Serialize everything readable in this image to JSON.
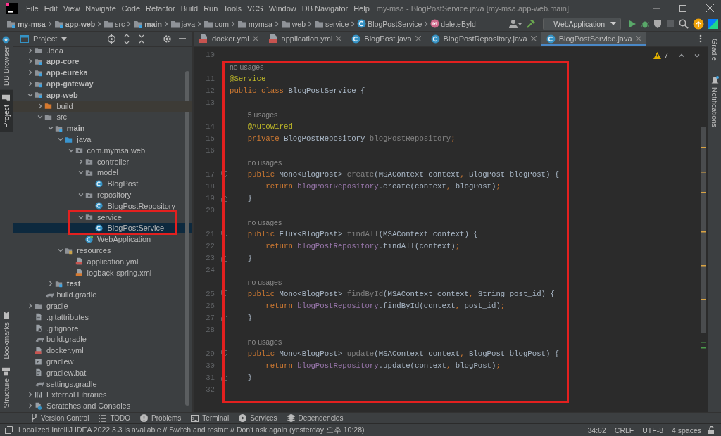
{
  "window": {
    "title": "my-msa - BlogPostService.java [my-msa.app-web.main]"
  },
  "menu": [
    "File",
    "Edit",
    "View",
    "Navigate",
    "Code",
    "Refactor",
    "Build",
    "Run",
    "Tools",
    "VCS",
    "Window",
    "DB Navigator",
    "Help"
  ],
  "breadcrumbs": [
    {
      "label": "my-msa",
      "kind": "module"
    },
    {
      "label": "app-web",
      "kind": "module"
    },
    {
      "label": "src",
      "kind": "folder"
    },
    {
      "label": "main",
      "kind": "module"
    },
    {
      "label": "java",
      "kind": "folder"
    },
    {
      "label": "com",
      "kind": "folder"
    },
    {
      "label": "mymsa",
      "kind": "folder"
    },
    {
      "label": "web",
      "kind": "folder"
    },
    {
      "label": "service",
      "kind": "folder"
    },
    {
      "label": "BlogPostService",
      "kind": "class"
    },
    {
      "label": "deleteById",
      "kind": "method"
    }
  ],
  "run_config": {
    "label": "WebApplication"
  },
  "side_tabs_left": {
    "top": [
      {
        "label": "DB Browser",
        "selected": false
      },
      {
        "label": "Project",
        "selected": true
      }
    ],
    "bottom": [
      {
        "label": "Bookmarks",
        "selected": false
      },
      {
        "label": "Structure",
        "selected": false
      }
    ]
  },
  "project_panel": {
    "title": "Project",
    "tree": [
      {
        "label": ".idea",
        "kind": "folder",
        "expanded": false,
        "selected": false
      },
      {
        "label": "app-core",
        "kind": "module",
        "expanded": false,
        "selected": false
      },
      {
        "label": "app-eureka",
        "kind": "module",
        "expanded": false,
        "selected": false
      },
      {
        "label": "app-gateway",
        "kind": "module",
        "expanded": false,
        "selected": false
      },
      {
        "label": "app-web",
        "kind": "module",
        "expanded": true,
        "selected": false,
        "children": [
          {
            "label": "build",
            "kind": "excluded",
            "expanded": false,
            "selected": false
          },
          {
            "label": "src",
            "kind": "folder",
            "expanded": true,
            "selected": false,
            "children": [
              {
                "label": "main",
                "kind": "module",
                "expanded": true,
                "selected": false,
                "children": [
                  {
                    "label": "java",
                    "kind": "source",
                    "expanded": true,
                    "selected": false,
                    "children": [
                      {
                        "label": "com.mymsa.web",
                        "kind": "package",
                        "expanded": true,
                        "selected": false,
                        "children": [
                          {
                            "label": "controller",
                            "kind": "package",
                            "expanded": false,
                            "selected": false
                          },
                          {
                            "label": "model",
                            "kind": "package",
                            "expanded": true,
                            "selected": false,
                            "children": [
                              {
                                "label": "BlogPost",
                                "kind": "class",
                                "selected": false
                              }
                            ]
                          },
                          {
                            "label": "repository",
                            "kind": "package",
                            "expanded": true,
                            "selected": false,
                            "children": [
                              {
                                "label": "BlogPostRepository",
                                "kind": "class",
                                "selected": false
                              }
                            ]
                          },
                          {
                            "label": "service",
                            "kind": "package",
                            "expanded": true,
                            "selected": false,
                            "children": [
                              {
                                "label": "BlogPostService",
                                "kind": "class",
                                "selected": true
                              }
                            ]
                          },
                          {
                            "label": "WebApplication",
                            "kind": "spring",
                            "selected": false
                          }
                        ]
                      }
                    ]
                  },
                  {
                    "label": "resources",
                    "kind": "resources",
                    "expanded": true,
                    "selected": false,
                    "children": [
                      {
                        "label": "application.yml",
                        "kind": "yml",
                        "selected": false
                      },
                      {
                        "label": "logback-spring.xml",
                        "kind": "xml",
                        "selected": false
                      }
                    ]
                  }
                ]
              },
              {
                "label": "test",
                "kind": "module",
                "expanded": false,
                "selected": false
              }
            ]
          },
          {
            "label": "build.gradle",
            "kind": "gradle",
            "selected": false
          }
        ]
      },
      {
        "label": "gradle",
        "kind": "folder",
        "expanded": false,
        "selected": false
      },
      {
        "label": ".gitattributes",
        "kind": "text",
        "selected": false
      },
      {
        "label": ".gitignore",
        "kind": "ignore",
        "selected": false
      },
      {
        "label": "build.gradle",
        "kind": "gradle",
        "selected": false
      },
      {
        "label": "docker.yml",
        "kind": "yml",
        "selected": false
      },
      {
        "label": "gradlew",
        "kind": "script",
        "selected": false
      },
      {
        "label": "gradlew.bat",
        "kind": "text",
        "selected": false
      },
      {
        "label": "settings.gradle",
        "kind": "gradle",
        "selected": false
      },
      {
        "label": "External Libraries",
        "kind": "libraries",
        "expanded": false,
        "selected": false
      },
      {
        "label": "Scratches and Consoles",
        "kind": "scratches",
        "expanded": false,
        "selected": false
      }
    ]
  },
  "editor": {
    "tabs": [
      {
        "label": "docker.yml",
        "kind": "yml",
        "selected": false
      },
      {
        "label": "application.yml",
        "kind": "yml",
        "selected": false
      },
      {
        "label": "BlogPost.java",
        "kind": "class",
        "selected": false
      },
      {
        "label": "BlogPostRepository.java",
        "kind": "class",
        "selected": false
      },
      {
        "label": "BlogPostService.java",
        "kind": "class",
        "selected": true
      }
    ],
    "warnings": "7",
    "lines": [
      {
        "kind": "code",
        "number": "10"
      },
      {
        "kind": "hint",
        "text": "no usages"
      },
      {
        "kind": "code",
        "number": "11",
        "tokens": [
          {
            "text": "@Service",
            "kind": "ann"
          }
        ]
      },
      {
        "kind": "code",
        "number": "12",
        "tokens": [
          {
            "text": "public class ",
            "kind": "kw"
          },
          {
            "text": "BlogPostService {",
            "kind": "plain"
          }
        ]
      },
      {
        "kind": "code",
        "number": "13"
      },
      {
        "kind": "hint",
        "text": "5 usages"
      },
      {
        "kind": "code",
        "number": "14",
        "tokens": [
          {
            "text": "    @Autowired",
            "kind": "ann"
          }
        ]
      },
      {
        "kind": "code",
        "number": "15",
        "tokens": [
          {
            "text": "    private ",
            "kind": "kw"
          },
          {
            "text": "BlogPostRepository ",
            "kind": "plain"
          },
          {
            "text": "blogPostRepository",
            "kind": "unused"
          },
          {
            "text": ";",
            "kind": "punct"
          }
        ]
      },
      {
        "kind": "code",
        "number": "16"
      },
      {
        "kind": "hint",
        "text": "no usages"
      },
      {
        "kind": "block-start",
        "number": "17",
        "tokens": [
          {
            "text": "    public ",
            "kind": "kw"
          },
          {
            "text": "Mono<BlogPost> ",
            "kind": "plain"
          },
          {
            "text": "create",
            "kind": "unused"
          },
          {
            "text": "(MSAContext context",
            "kind": "plain"
          },
          {
            "text": ",",
            "kind": "punct"
          },
          {
            "text": " BlogPost blogPost) {",
            "kind": "plain"
          }
        ]
      },
      {
        "kind": "code",
        "number": "18",
        "tokens": [
          {
            "text": "        return ",
            "kind": "kw"
          },
          {
            "text": "blogPostRepository",
            "kind": "field"
          },
          {
            "text": ".create(context",
            "kind": "plain"
          },
          {
            "text": ",",
            "kind": "punct"
          },
          {
            "text": " blogPost)",
            "kind": "plain"
          },
          {
            "text": ";",
            "kind": "punct"
          }
        ]
      },
      {
        "kind": "block-end",
        "number": "19",
        "tokens": [
          {
            "text": "    }",
            "kind": "plain"
          }
        ]
      },
      {
        "kind": "code",
        "number": "20"
      },
      {
        "kind": "hint",
        "text": "no usages"
      },
      {
        "kind": "block-start",
        "number": "21",
        "tokens": [
          {
            "text": "    public ",
            "kind": "kw"
          },
          {
            "text": "Flux<BlogPost> ",
            "kind": "plain"
          },
          {
            "text": "findAll",
            "kind": "unused"
          },
          {
            "text": "(MSAContext context) {",
            "kind": "plain"
          }
        ]
      },
      {
        "kind": "code",
        "number": "22",
        "tokens": [
          {
            "text": "        return ",
            "kind": "kw"
          },
          {
            "text": "blogPostRepository",
            "kind": "field"
          },
          {
            "text": ".findAll(context)",
            "kind": "plain"
          },
          {
            "text": ";",
            "kind": "punct"
          }
        ]
      },
      {
        "kind": "block-end",
        "number": "23",
        "tokens": [
          {
            "text": "    }",
            "kind": "plain"
          }
        ]
      },
      {
        "kind": "code",
        "number": "24"
      },
      {
        "kind": "hint",
        "text": "no usages"
      },
      {
        "kind": "block-start",
        "number": "25",
        "tokens": [
          {
            "text": "    public ",
            "kind": "kw"
          },
          {
            "text": "Mono<BlogPost> ",
            "kind": "plain"
          },
          {
            "text": "findById",
            "kind": "unused"
          },
          {
            "text": "(MSAContext context",
            "kind": "plain"
          },
          {
            "text": ",",
            "kind": "punct"
          },
          {
            "text": " String post_id) {",
            "kind": "plain"
          }
        ]
      },
      {
        "kind": "code",
        "number": "26",
        "tokens": [
          {
            "text": "        return ",
            "kind": "kw"
          },
          {
            "text": "blogPostRepository",
            "kind": "field"
          },
          {
            "text": ".findById(context",
            "kind": "plain"
          },
          {
            "text": ",",
            "kind": "punct"
          },
          {
            "text": " post_id)",
            "kind": "plain"
          },
          {
            "text": ";",
            "kind": "punct"
          }
        ]
      },
      {
        "kind": "block-end",
        "number": "27",
        "tokens": [
          {
            "text": "    }",
            "kind": "plain"
          }
        ]
      },
      {
        "kind": "code",
        "number": "28"
      },
      {
        "kind": "hint",
        "text": "no usages"
      },
      {
        "kind": "block-start",
        "number": "29",
        "tokens": [
          {
            "text": "    public ",
            "kind": "kw"
          },
          {
            "text": "Mono<BlogPost> ",
            "kind": "plain"
          },
          {
            "text": "update",
            "kind": "unused"
          },
          {
            "text": "(MSAContext context",
            "kind": "plain"
          },
          {
            "text": ",",
            "kind": "punct"
          },
          {
            "text": " BlogPost blogPost) {",
            "kind": "plain"
          }
        ]
      },
      {
        "kind": "code",
        "number": "30",
        "tokens": [
          {
            "text": "        return ",
            "kind": "kw"
          },
          {
            "text": "blogPostRepository",
            "kind": "field"
          },
          {
            "text": ".update(context",
            "kind": "plain"
          },
          {
            "text": ",",
            "kind": "punct"
          },
          {
            "text": " blogPost)",
            "kind": "plain"
          },
          {
            "text": ";",
            "kind": "punct"
          }
        ]
      },
      {
        "kind": "block-end",
        "number": "31",
        "tokens": [
          {
            "text": "    }",
            "kind": "plain"
          }
        ]
      },
      {
        "kind": "code",
        "number": "32"
      }
    ]
  },
  "side_tabs_right": [
    {
      "label": "Gradle"
    },
    {
      "label": "Notifications"
    }
  ],
  "tool_windows": [
    "Version Control",
    "TODO",
    "Problems",
    "Terminal",
    "Services",
    "Dependencies"
  ],
  "status_bar": {
    "message": "Localized IntelliJ IDEA 2022.3.3 is available // Switch and restart // Don't ask again (yesterday 오후 10:28)",
    "items": [
      "34:62",
      "CRLF",
      "UTF-8",
      "4 spaces"
    ]
  }
}
